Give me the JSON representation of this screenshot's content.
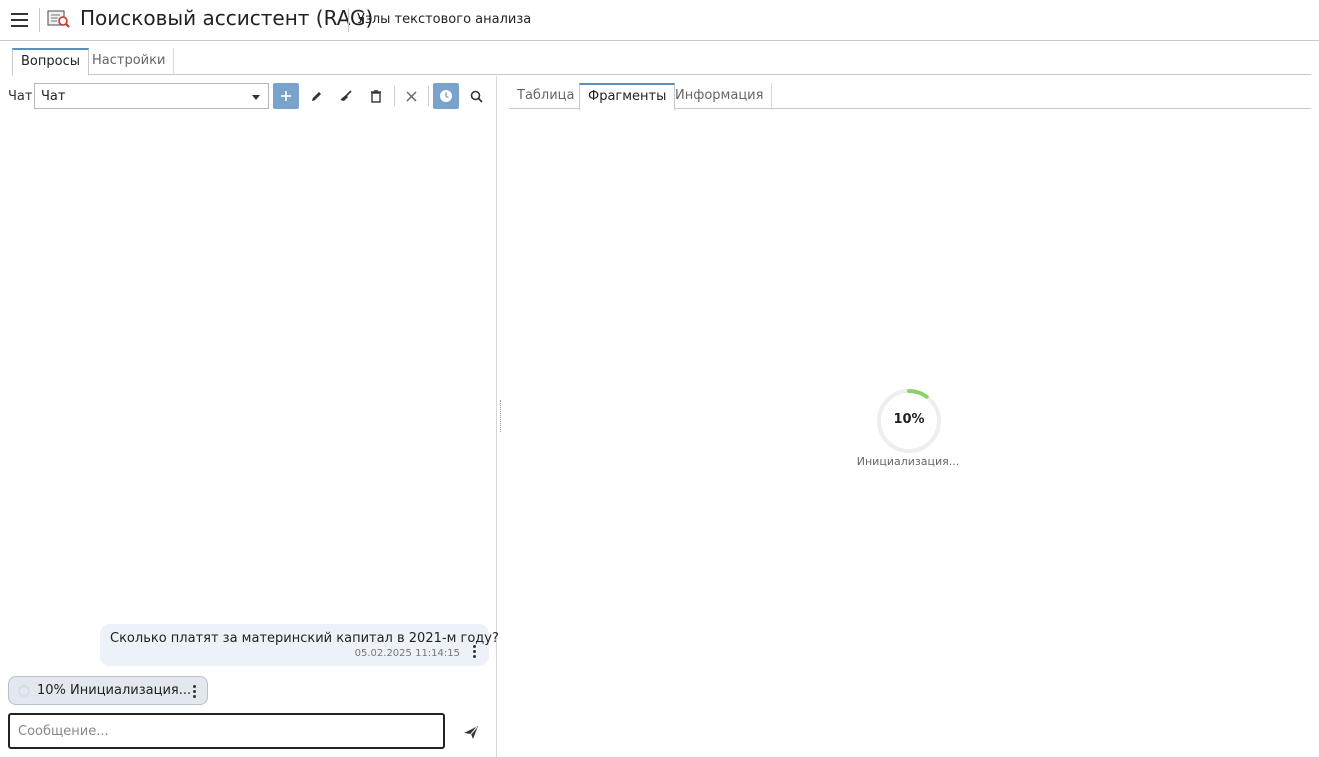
{
  "header": {
    "menu_icon": "hamburger-icon",
    "app_icon": "search-document-icon",
    "title": "Поисковый ассистент (RAG)",
    "subtitle": "Узлы текстового анализа"
  },
  "main_tabs": [
    {
      "label": "Вопросы",
      "active": true
    },
    {
      "label": "Настройки",
      "active": false
    }
  ],
  "chat_toolbar": {
    "label": "Чат",
    "selected_chat": "Чат",
    "buttons": [
      "plus-icon",
      "pencil-icon",
      "broom-icon",
      "trash-icon",
      "close-icon",
      "clock-icon",
      "search-icon"
    ]
  },
  "messages": {
    "user": {
      "text": "Сколько платят за материнский капитал в 2021-м году?",
      "timestamp": "05.02.2025 11:14:15"
    },
    "status": {
      "text": "10% Инициализация..."
    }
  },
  "composer": {
    "placeholder": "Сообщение...",
    "send_icon": "send-icon"
  },
  "right_tabs": [
    {
      "label": "Таблица",
      "active": false
    },
    {
      "label": "Фрагменты",
      "active": true
    },
    {
      "label": "Информация",
      "active": false
    }
  ],
  "progress": {
    "percent_text": "10%",
    "value": 0.1,
    "label": "Инициализация...",
    "color": "#8ed06a"
  },
  "colors": {
    "accent": "#7aa3cc",
    "tab_active_border": "#5b8fbf",
    "user_bubble": "#edf2f9",
    "status_bubble": "#e3e8ef"
  }
}
